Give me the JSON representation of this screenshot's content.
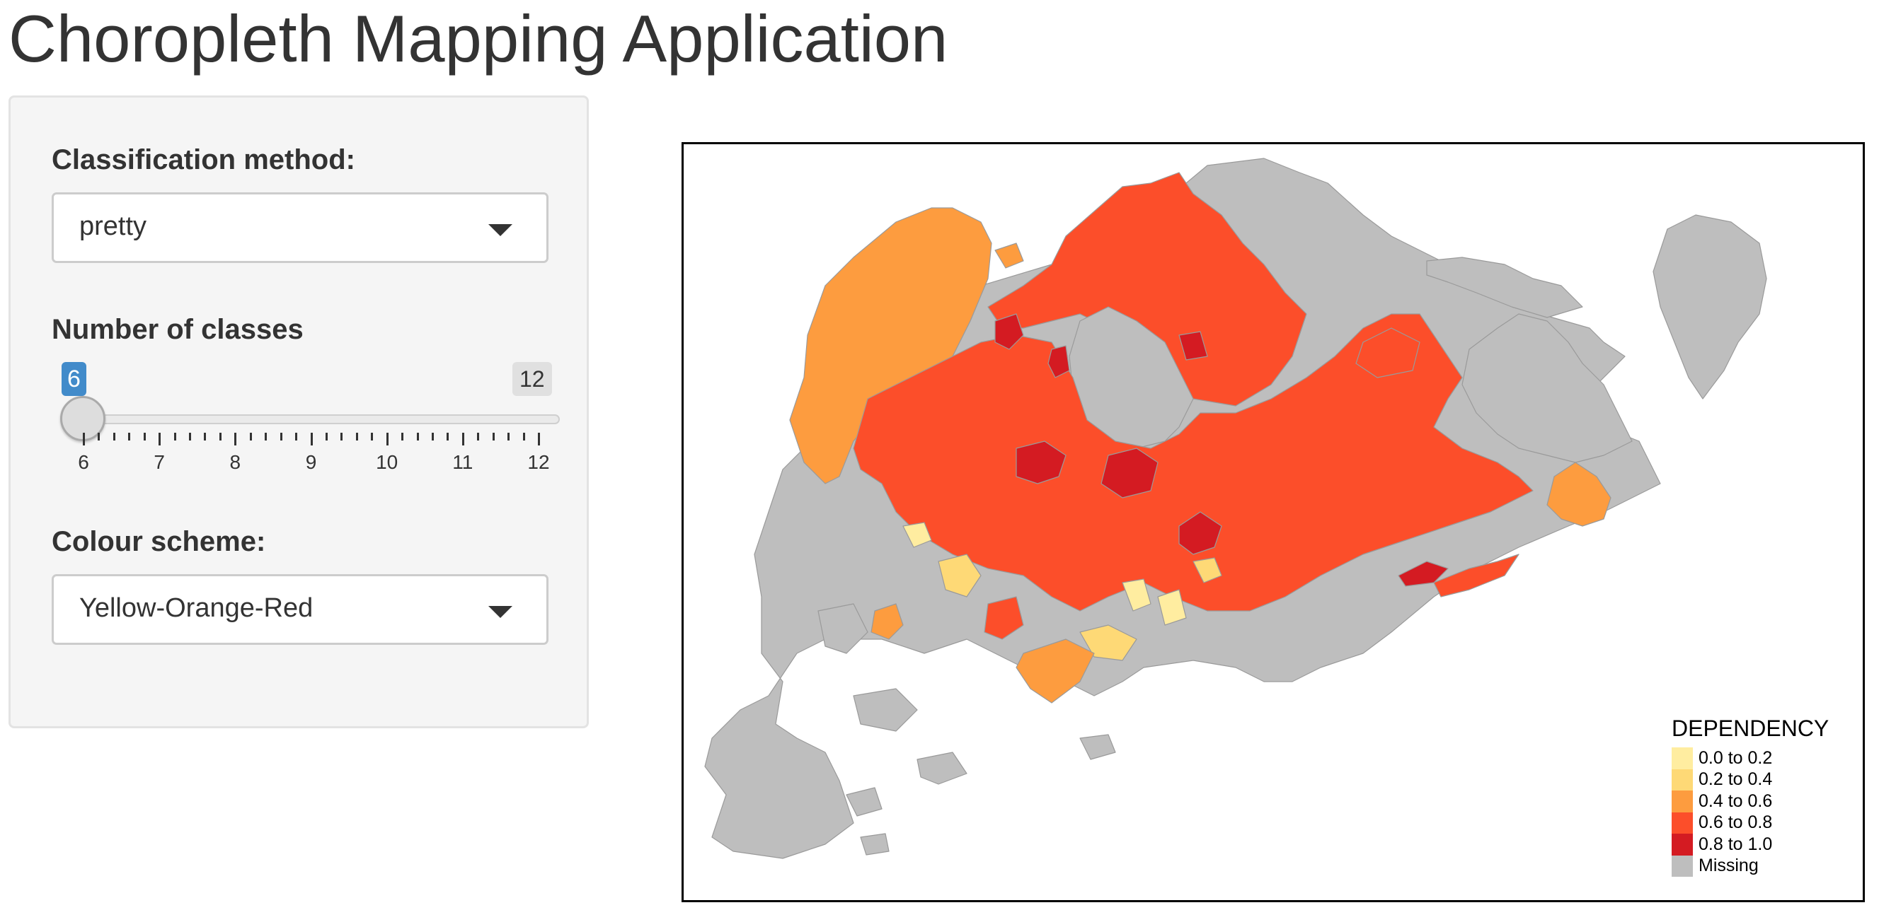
{
  "app": {
    "title": "Choropleth Mapping Application"
  },
  "sidebar": {
    "classification": {
      "label": "Classification method:",
      "value": "pretty"
    },
    "classes": {
      "label": "Number of classes",
      "value": 6,
      "min": 6,
      "max": 12,
      "value_text": "6",
      "max_text": "12",
      "ticks": [
        "6",
        "7",
        "8",
        "9",
        "10",
        "11",
        "12"
      ]
    },
    "colour_scheme": {
      "label": "Colour scheme:",
      "value": "Yellow-Orange-Red"
    }
  },
  "legend": {
    "title": "DEPENDENCY",
    "items": [
      {
        "label": "0.0 to 0.2",
        "color": "#ffeda0"
      },
      {
        "label": "0.2 to 0.4",
        "color": "#fed976"
      },
      {
        "label": "0.4 to 0.6",
        "color": "#fd9c3f"
      },
      {
        "label": "0.6 to 0.8",
        "color": "#fc4e2a"
      },
      {
        "label": "0.8 to 1.0",
        "color": "#d41b22"
      },
      {
        "label": "Missing",
        "color": "#bebebe"
      }
    ]
  },
  "colors": {
    "missing": "#bebebe",
    "c1": "#ffeda0",
    "c2": "#fed976",
    "c3": "#fd9c3f",
    "c4": "#fc4e2a",
    "c5": "#d41b22",
    "slider_accent": "#428bca"
  }
}
